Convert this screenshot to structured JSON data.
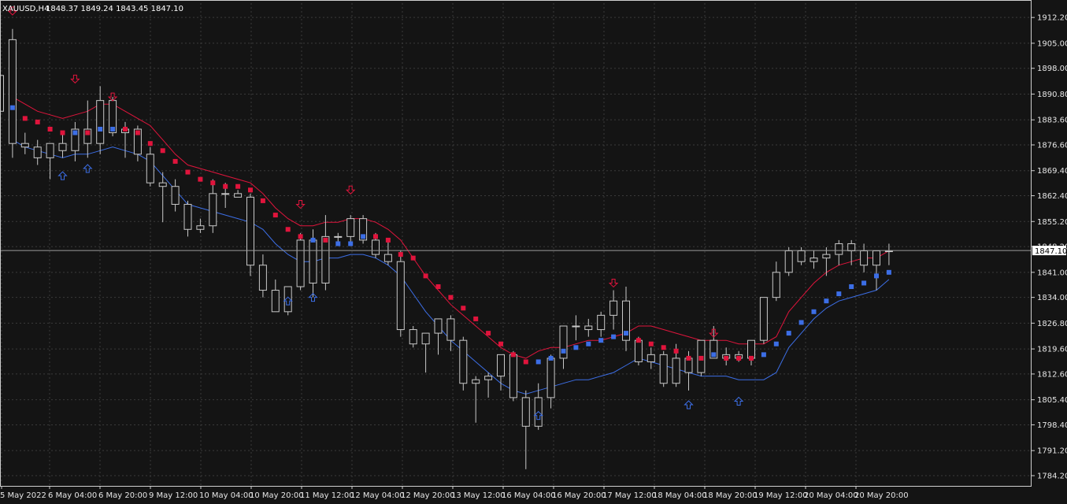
{
  "window": {
    "symbol_timeframe": "XAUUSD,H4",
    "ohlc": "1848.37 1849.24 1843.45 1847.10"
  },
  "colors": {
    "background": "#141414",
    "grid": "#3a3a3a",
    "candle": "#c8c8c8",
    "upper_band": "#e0143c",
    "lower_band": "#3c6ee6",
    "dot_bearish": "#e0143c",
    "dot_bullish": "#3c6ee6",
    "arrow_down": "#e0143c",
    "arrow_up": "#3c6ee6",
    "price_line": "#9a9a9a"
  },
  "chart_data": {
    "type": "candlestick",
    "title": "XAUUSD,H4",
    "ylim": [
      1782.0,
      1916.2
    ],
    "grid": true,
    "y_ticks": [
      "1912.20",
      "1905.00",
      "1898.00",
      "1890.80",
      "1883.60",
      "1876.60",
      "1869.40",
      "1862.40",
      "1855.20",
      "1848.20",
      "1841.00",
      "1834.00",
      "1826.80",
      "1819.60",
      "1812.60",
      "1805.40",
      "1798.40",
      "1791.20",
      "1784.20"
    ],
    "current_price": "1847.10",
    "x_labels": [
      "5 May 2022",
      "6 May 04:00",
      "6 May 20:00",
      "9 May 12:00",
      "10 May 04:00",
      "10 May 20:00",
      "11 May 12:00",
      "12 May 04:00",
      "12 May 20:00",
      "13 May 12:00",
      "16 May 04:00",
      "16 May 20:00",
      "17 May 12:00",
      "18 May 04:00",
      "18 May 20:00",
      "19 May 12:00",
      "20 May 04:00",
      "20 May 20:00"
    ],
    "candles": [
      {
        "o": 1896,
        "h": 1906,
        "l": 1882,
        "c": 1886
      },
      {
        "o": 1906,
        "h": 1909,
        "l": 1873,
        "c": 1877
      },
      {
        "o": 1877,
        "h": 1880,
        "l": 1874,
        "c": 1876
      },
      {
        "o": 1876,
        "h": 1878,
        "l": 1871,
        "c": 1873
      },
      {
        "o": 1873,
        "h": 1876,
        "l": 1867,
        "c": 1877
      },
      {
        "o": 1877,
        "h": 1880,
        "l": 1873,
        "c": 1875
      },
      {
        "o": 1875,
        "h": 1883,
        "l": 1872,
        "c": 1881
      },
      {
        "o": 1881,
        "h": 1889,
        "l": 1873,
        "c": 1877
      },
      {
        "o": 1877,
        "h": 1893,
        "l": 1874,
        "c": 1889
      },
      {
        "o": 1889,
        "h": 1890,
        "l": 1879,
        "c": 1880
      },
      {
        "o": 1880,
        "h": 1883,
        "l": 1873,
        "c": 1881
      },
      {
        "o": 1881,
        "h": 1882,
        "l": 1872,
        "c": 1874
      },
      {
        "o": 1874,
        "h": 1876,
        "l": 1865,
        "c": 1866
      },
      {
        "o": 1866,
        "h": 1869,
        "l": 1855,
        "c": 1865
      },
      {
        "o": 1865,
        "h": 1867,
        "l": 1858,
        "c": 1860
      },
      {
        "o": 1860,
        "h": 1861,
        "l": 1851,
        "c": 1853
      },
      {
        "o": 1853,
        "h": 1856,
        "l": 1852,
        "c": 1854
      },
      {
        "o": 1854,
        "h": 1867,
        "l": 1852,
        "c": 1863
      },
      {
        "o": 1863,
        "h": 1866,
        "l": 1859,
        "c": 1863
      },
      {
        "o": 1863,
        "h": 1864,
        "l": 1862,
        "c": 1862
      },
      {
        "o": 1862,
        "h": 1863,
        "l": 1840,
        "c": 1843
      },
      {
        "o": 1843,
        "h": 1846,
        "l": 1834,
        "c": 1836
      },
      {
        "o": 1836,
        "h": 1839,
        "l": 1830,
        "c": 1830
      },
      {
        "o": 1830,
        "h": 1837,
        "l": 1829,
        "c": 1837
      },
      {
        "o": 1837,
        "h": 1852,
        "l": 1836,
        "c": 1850
      },
      {
        "o": 1850,
        "h": 1853,
        "l": 1834,
        "c": 1838
      },
      {
        "o": 1838,
        "h": 1857,
        "l": 1836,
        "c": 1851
      },
      {
        "o": 1851,
        "h": 1852,
        "l": 1849,
        "c": 1851
      },
      {
        "o": 1851,
        "h": 1857,
        "l": 1849,
        "c": 1856
      },
      {
        "o": 1856,
        "h": 1857,
        "l": 1849,
        "c": 1850
      },
      {
        "o": 1850,
        "h": 1852,
        "l": 1845,
        "c": 1846
      },
      {
        "o": 1846,
        "h": 1850,
        "l": 1843,
        "c": 1844
      },
      {
        "o": 1844,
        "h": 1847,
        "l": 1823,
        "c": 1825
      },
      {
        "o": 1825,
        "h": 1826,
        "l": 1820,
        "c": 1821
      },
      {
        "o": 1821,
        "h": 1824,
        "l": 1813,
        "c": 1824
      },
      {
        "o": 1824,
        "h": 1828,
        "l": 1818,
        "c": 1828
      },
      {
        "o": 1828,
        "h": 1829,
        "l": 1819,
        "c": 1822
      },
      {
        "o": 1822,
        "h": 1823,
        "l": 1808,
        "c": 1810
      },
      {
        "o": 1810,
        "h": 1812,
        "l": 1799,
        "c": 1811
      },
      {
        "o": 1811,
        "h": 1813,
        "l": 1806,
        "c": 1812
      },
      {
        "o": 1812,
        "h": 1818,
        "l": 1808,
        "c": 1818
      },
      {
        "o": 1818,
        "h": 1819,
        "l": 1805,
        "c": 1806
      },
      {
        "o": 1806,
        "h": 1808,
        "l": 1786,
        "c": 1798
      },
      {
        "o": 1798,
        "h": 1810,
        "l": 1797,
        "c": 1806
      },
      {
        "o": 1806,
        "h": 1818,
        "l": 1803,
        "c": 1817
      },
      {
        "o": 1817,
        "h": 1826,
        "l": 1814,
        "c": 1826
      },
      {
        "o": 1826,
        "h": 1829,
        "l": 1822,
        "c": 1826
      },
      {
        "o": 1826,
        "h": 1828,
        "l": 1823,
        "c": 1825
      },
      {
        "o": 1825,
        "h": 1830,
        "l": 1823,
        "c": 1829
      },
      {
        "o": 1829,
        "h": 1836,
        "l": 1825,
        "c": 1833
      },
      {
        "o": 1833,
        "h": 1837,
        "l": 1819,
        "c": 1822
      },
      {
        "o": 1822,
        "h": 1823,
        "l": 1815,
        "c": 1816
      },
      {
        "o": 1816,
        "h": 1820,
        "l": 1814,
        "c": 1818
      },
      {
        "o": 1818,
        "h": 1819,
        "l": 1809,
        "c": 1810
      },
      {
        "o": 1810,
        "h": 1821,
        "l": 1809,
        "c": 1817
      },
      {
        "o": 1817,
        "h": 1819,
        "l": 1808,
        "c": 1813
      },
      {
        "o": 1813,
        "h": 1822,
        "l": 1812,
        "c": 1822
      },
      {
        "o": 1822,
        "h": 1826,
        "l": 1817,
        "c": 1817
      },
      {
        "o": 1817,
        "h": 1820,
        "l": 1815,
        "c": 1818
      },
      {
        "o": 1818,
        "h": 1819,
        "l": 1816,
        "c": 1817
      },
      {
        "o": 1817,
        "h": 1822,
        "l": 1815,
        "c": 1822
      },
      {
        "o": 1822,
        "h": 1834,
        "l": 1821,
        "c": 1834
      },
      {
        "o": 1834,
        "h": 1844,
        "l": 1833,
        "c": 1841
      },
      {
        "o": 1841,
        "h": 1848,
        "l": 1840,
        "c": 1847
      },
      {
        "o": 1847,
        "h": 1848,
        "l": 1843,
        "c": 1844
      },
      {
        "o": 1844,
        "h": 1847,
        "l": 1842,
        "c": 1845
      },
      {
        "o": 1845,
        "h": 1848,
        "l": 1840,
        "c": 1846
      },
      {
        "o": 1846,
        "h": 1850,
        "l": 1843,
        "c": 1849
      },
      {
        "o": 1849,
        "h": 1850,
        "l": 1843,
        "c": 1847
      },
      {
        "o": 1847,
        "h": 1849,
        "l": 1841,
        "c": 1843
      },
      {
        "o": 1843,
        "h": 1846,
        "l": 1836,
        "c": 1847
      },
      {
        "o": 1847,
        "h": 1849,
        "l": 1843,
        "c": 1847
      }
    ],
    "upper_band": [
      1890,
      1888,
      1886,
      1885,
      1884,
      1885,
      1886,
      1888,
      1888,
      1886,
      1884,
      1882,
      1878,
      1874,
      1871,
      1870,
      1869,
      1868,
      1867,
      1866,
      1863,
      1859,
      1856,
      1854,
      1854,
      1855,
      1855,
      1856,
      1856,
      1855,
      1853,
      1850,
      1845,
      1840,
      1836,
      1832,
      1829,
      1826,
      1823,
      1820,
      1818,
      1817,
      1819,
      1820,
      1820,
      1821,
      1822,
      1822,
      1823,
      1824,
      1826,
      1826,
      1825,
      1824,
      1823,
      1822,
      1822,
      1822,
      1821,
      1821,
      1821,
      1823,
      1830,
      1834,
      1838,
      1841,
      1843,
      1844,
      1845,
      1845,
      1847
    ],
    "lower_band": [
      1878,
      1876,
      1875,
      1874,
      1873,
      1874,
      1874,
      1875,
      1876,
      1875,
      1874,
      1872,
      1868,
      1864,
      1860,
      1859,
      1858,
      1857,
      1856,
      1855,
      1853,
      1849,
      1846,
      1844,
      1844,
      1845,
      1845,
      1846,
      1846,
      1845,
      1843,
      1840,
      1835,
      1830,
      1826,
      1822,
      1819,
      1816,
      1813,
      1810,
      1808,
      1807,
      1808,
      1809,
      1810,
      1811,
      1811,
      1812,
      1813,
      1815,
      1817,
      1816,
      1815,
      1814,
      1813,
      1812,
      1812,
      1812,
      1811,
      1811,
      1811,
      1813,
      1820,
      1824,
      1828,
      1831,
      1833,
      1834,
      1835,
      1836,
      1839
    ],
    "dots": [
      {
        "i": 0,
        "v": 1887,
        "kind": "bullish"
      },
      {
        "i": 1,
        "v": 1884,
        "kind": "bearish"
      },
      {
        "i": 2,
        "v": 1883,
        "kind": "bearish"
      },
      {
        "i": 3,
        "v": 1881,
        "kind": "bearish"
      },
      {
        "i": 4,
        "v": 1880,
        "kind": "bearish"
      },
      {
        "i": 5,
        "v": 1880,
        "kind": "bullish"
      },
      {
        "i": 6,
        "v": 1880,
        "kind": "bearish"
      },
      {
        "i": 7,
        "v": 1881,
        "kind": "bullish"
      },
      {
        "i": 8,
        "v": 1881,
        "kind": "bullish"
      },
      {
        "i": 9,
        "v": 1881,
        "kind": "bearish"
      },
      {
        "i": 10,
        "v": 1880,
        "kind": "bearish"
      },
      {
        "i": 11,
        "v": 1877,
        "kind": "bearish"
      },
      {
        "i": 12,
        "v": 1875,
        "kind": "bearish"
      },
      {
        "i": 13,
        "v": 1872,
        "kind": "bearish"
      },
      {
        "i": 14,
        "v": 1869,
        "kind": "bearish"
      },
      {
        "i": 15,
        "v": 1867,
        "kind": "bearish"
      },
      {
        "i": 16,
        "v": 1866,
        "kind": "bearish"
      },
      {
        "i": 17,
        "v": 1865,
        "kind": "bearish"
      },
      {
        "i": 18,
        "v": 1865,
        "kind": "bearish"
      },
      {
        "i": 19,
        "v": 1864,
        "kind": "bearish"
      },
      {
        "i": 20,
        "v": 1861,
        "kind": "bearish"
      },
      {
        "i": 21,
        "v": 1857,
        "kind": "bearish"
      },
      {
        "i": 22,
        "v": 1853,
        "kind": "bearish"
      },
      {
        "i": 23,
        "v": 1851,
        "kind": "bearish"
      },
      {
        "i": 24,
        "v": 1850,
        "kind": "bullish"
      },
      {
        "i": 25,
        "v": 1850,
        "kind": "bearish"
      },
      {
        "i": 26,
        "v": 1849,
        "kind": "bullish"
      },
      {
        "i": 27,
        "v": 1849,
        "kind": "bullish"
      },
      {
        "i": 28,
        "v": 1851,
        "kind": "bullish"
      },
      {
        "i": 29,
        "v": 1851,
        "kind": "bearish"
      },
      {
        "i": 30,
        "v": 1850,
        "kind": "bearish"
      },
      {
        "i": 31,
        "v": 1846,
        "kind": "bearish"
      },
      {
        "i": 32,
        "v": 1845,
        "kind": "bearish"
      },
      {
        "i": 33,
        "v": 1840,
        "kind": "bearish"
      },
      {
        "i": 34,
        "v": 1837,
        "kind": "bearish"
      },
      {
        "i": 35,
        "v": 1834,
        "kind": "bearish"
      },
      {
        "i": 36,
        "v": 1831,
        "kind": "bearish"
      },
      {
        "i": 37,
        "v": 1828,
        "kind": "bearish"
      },
      {
        "i": 38,
        "v": 1824,
        "kind": "bearish"
      },
      {
        "i": 39,
        "v": 1821,
        "kind": "bearish"
      },
      {
        "i": 40,
        "v": 1818,
        "kind": "bearish"
      },
      {
        "i": 41,
        "v": 1816,
        "kind": "bearish"
      },
      {
        "i": 42,
        "v": 1816,
        "kind": "bullish"
      },
      {
        "i": 43,
        "v": 1817,
        "kind": "bullish"
      },
      {
        "i": 44,
        "v": 1819,
        "kind": "bullish"
      },
      {
        "i": 45,
        "v": 1820,
        "kind": "bullish"
      },
      {
        "i": 46,
        "v": 1821,
        "kind": "bullish"
      },
      {
        "i": 47,
        "v": 1822,
        "kind": "bullish"
      },
      {
        "i": 48,
        "v": 1823,
        "kind": "bullish"
      },
      {
        "i": 49,
        "v": 1824,
        "kind": "bullish"
      },
      {
        "i": 50,
        "v": 1822,
        "kind": "bearish"
      },
      {
        "i": 51,
        "v": 1821,
        "kind": "bearish"
      },
      {
        "i": 52,
        "v": 1820,
        "kind": "bearish"
      },
      {
        "i": 53,
        "v": 1819,
        "kind": "bearish"
      },
      {
        "i": 54,
        "v": 1817,
        "kind": "bearish"
      },
      {
        "i": 55,
        "v": 1817,
        "kind": "bearish"
      },
      {
        "i": 56,
        "v": 1818,
        "kind": "bullish"
      },
      {
        "i": 57,
        "v": 1817,
        "kind": "bearish"
      },
      {
        "i": 58,
        "v": 1817,
        "kind": "bearish"
      },
      {
        "i": 59,
        "v": 1817,
        "kind": "bearish"
      },
      {
        "i": 60,
        "v": 1818,
        "kind": "bullish"
      },
      {
        "i": 61,
        "v": 1821,
        "kind": "bullish"
      },
      {
        "i": 62,
        "v": 1824,
        "kind": "bullish"
      },
      {
        "i": 63,
        "v": 1827,
        "kind": "bullish"
      },
      {
        "i": 64,
        "v": 1830,
        "kind": "bullish"
      },
      {
        "i": 65,
        "v": 1833,
        "kind": "bullish"
      },
      {
        "i": 66,
        "v": 1835,
        "kind": "bullish"
      },
      {
        "i": 67,
        "v": 1837,
        "kind": "bullish"
      },
      {
        "i": 68,
        "v": 1838,
        "kind": "bullish"
      },
      {
        "i": 69,
        "v": 1840,
        "kind": "bullish"
      },
      {
        "i": 70,
        "v": 1841,
        "kind": "bullish"
      }
    ],
    "arrows_down": [
      {
        "i": 1,
        "v": 1914
      },
      {
        "i": 6,
        "v": 1895
      },
      {
        "i": 9,
        "v": 1890
      },
      {
        "i": 24,
        "v": 1860
      },
      {
        "i": 28,
        "v": 1864
      },
      {
        "i": 49,
        "v": 1838
      },
      {
        "i": 57,
        "v": 1824
      }
    ],
    "arrows_up": [
      {
        "i": 5,
        "v": 1868
      },
      {
        "i": 7,
        "v": 1870
      },
      {
        "i": 23,
        "v": 1833
      },
      {
        "i": 25,
        "v": 1834
      },
      {
        "i": 43,
        "v": 1801
      },
      {
        "i": 55,
        "v": 1804
      },
      {
        "i": 59,
        "v": 1805
      }
    ]
  }
}
